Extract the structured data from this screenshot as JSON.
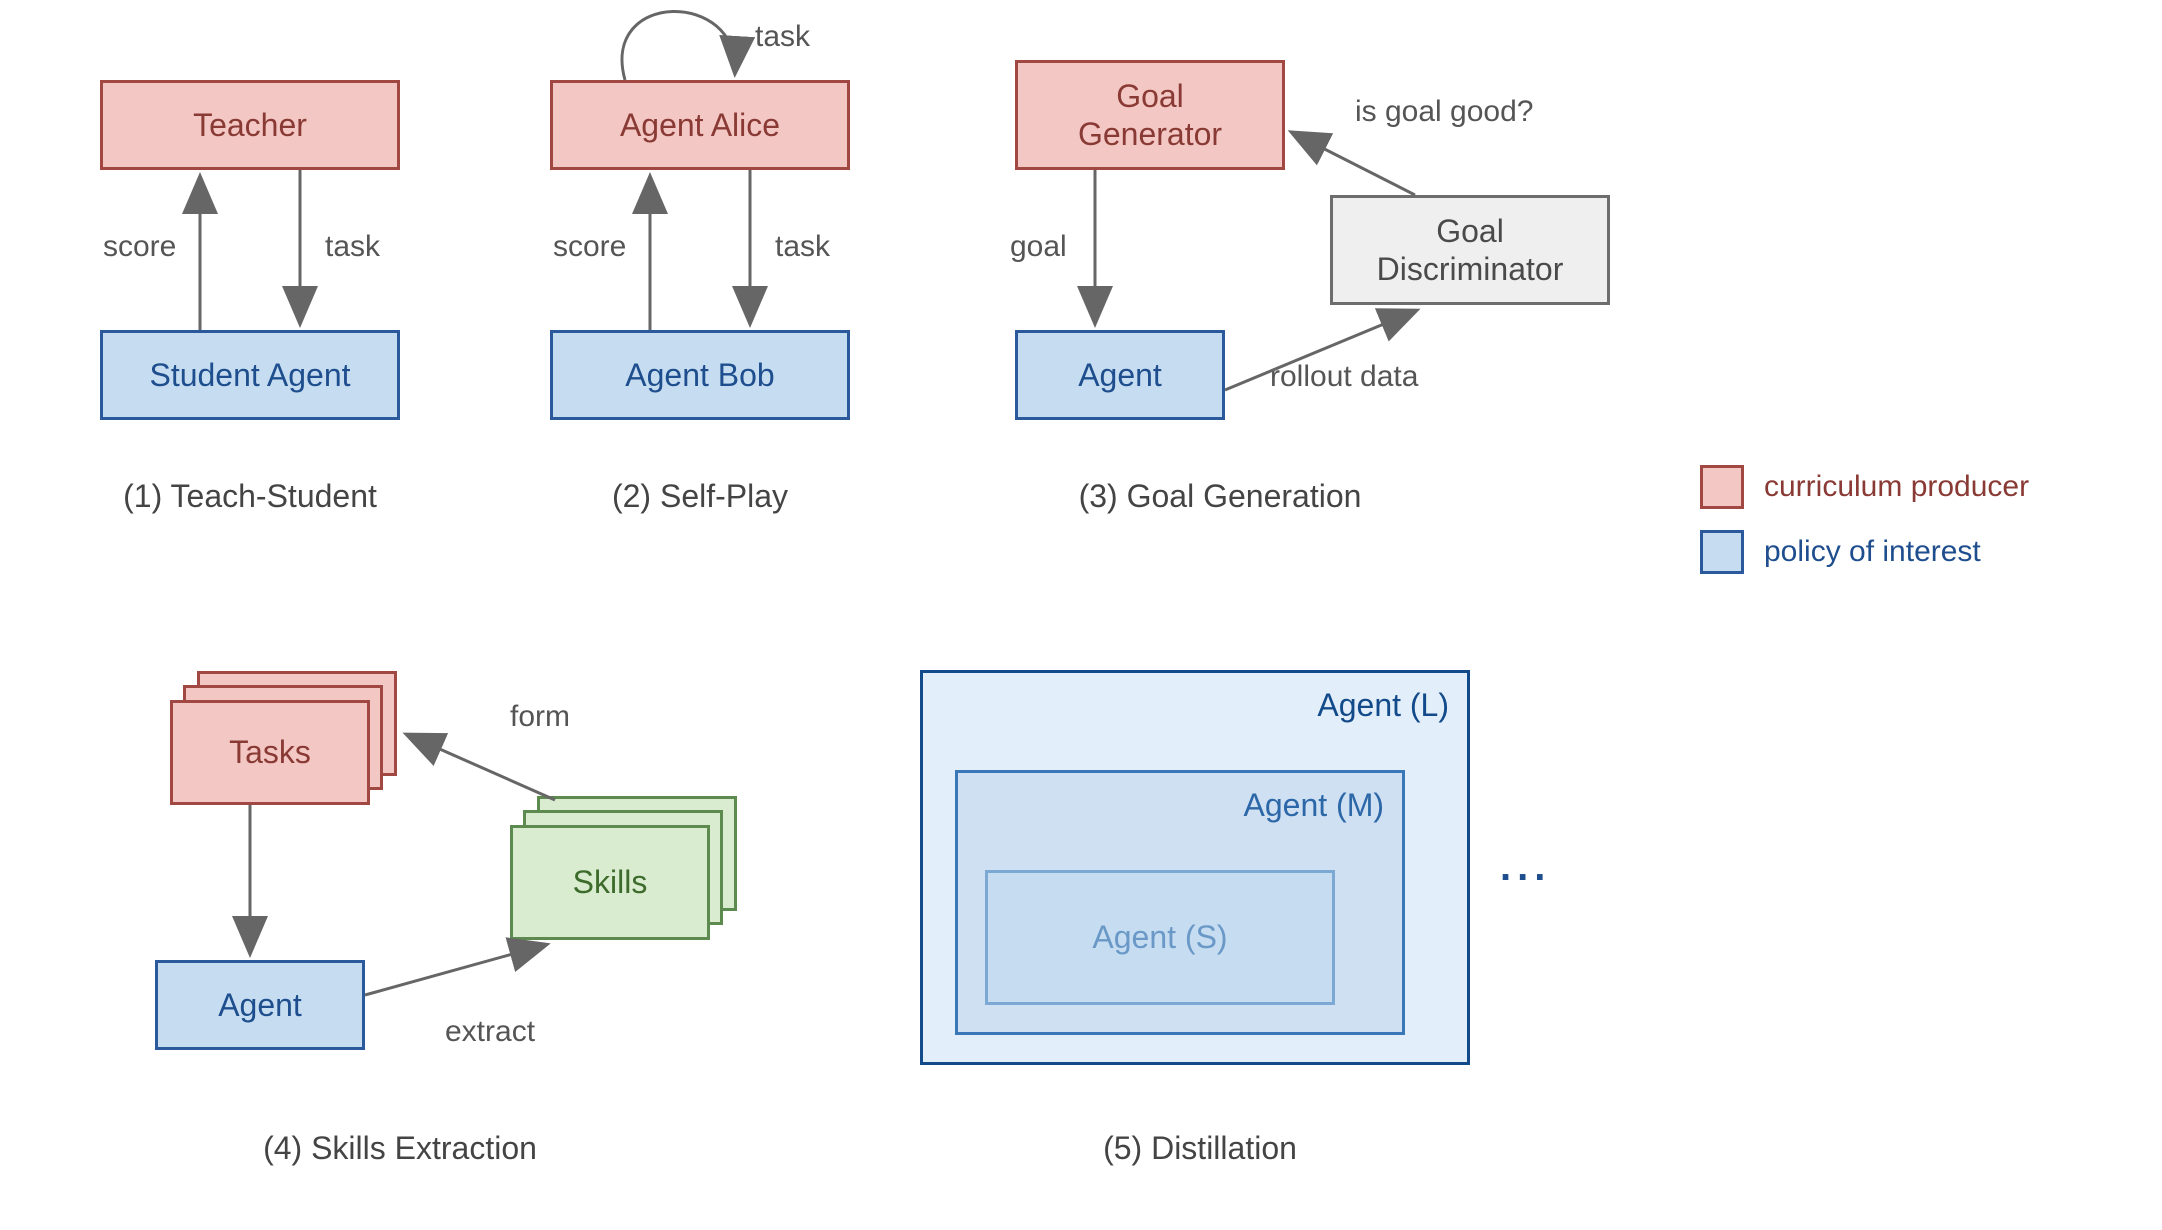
{
  "panels": {
    "p1": {
      "caption": "(1) Teach-Student",
      "teacher": "Teacher",
      "student": "Student Agent",
      "score": "score",
      "task": "task"
    },
    "p2": {
      "caption": "(2) Self-Play",
      "alice": "Agent Alice",
      "bob": "Agent Bob",
      "score": "score",
      "task": "task",
      "selfTask": "task"
    },
    "p3": {
      "caption": "(3) Goal Generation",
      "goalGen": "Goal\nGenerator",
      "agent": "Agent",
      "goalDisc": "Goal\nDiscriminator",
      "goal": "goal",
      "rollout": "rollout data",
      "isGood": "is goal good?"
    },
    "p4": {
      "caption": "(4) Skills Extraction",
      "tasks": "Tasks",
      "agent": "Agent",
      "skills": "Skills",
      "form": "form",
      "extract": "extract"
    },
    "p5": {
      "caption": "(5) Distillation",
      "agentL": "Agent (L)",
      "agentM": "Agent (M)",
      "agentS": "Agent (S)",
      "dots": "..."
    }
  },
  "legend": {
    "curriculum": "curriculum producer",
    "policy": "policy of interest"
  },
  "chart_data": {
    "type": "diagram",
    "title": "Curriculum learning approaches",
    "nodes": [
      {
        "id": "teacher",
        "panel": 1,
        "label": "Teacher",
        "role": "curriculum_producer"
      },
      {
        "id": "student",
        "panel": 1,
        "label": "Student Agent",
        "role": "policy_of_interest"
      },
      {
        "id": "alice",
        "panel": 2,
        "label": "Agent Alice",
        "role": "curriculum_producer"
      },
      {
        "id": "bob",
        "panel": 2,
        "label": "Agent Bob",
        "role": "policy_of_interest"
      },
      {
        "id": "goal_generator",
        "panel": 3,
        "label": "Goal Generator",
        "role": "curriculum_producer"
      },
      {
        "id": "agent3",
        "panel": 3,
        "label": "Agent",
        "role": "policy_of_interest"
      },
      {
        "id": "goal_discriminator",
        "panel": 3,
        "label": "Goal Discriminator",
        "role": "other"
      },
      {
        "id": "tasks",
        "panel": 4,
        "label": "Tasks",
        "role": "curriculum_producer"
      },
      {
        "id": "agent4",
        "panel": 4,
        "label": "Agent",
        "role": "policy_of_interest"
      },
      {
        "id": "skills",
        "panel": 4,
        "label": "Skills",
        "role": "other"
      },
      {
        "id": "agentL",
        "panel": 5,
        "label": "Agent (L)",
        "role": "policy_of_interest"
      },
      {
        "id": "agentM",
        "panel": 5,
        "label": "Agent (M)",
        "role": "policy_of_interest"
      },
      {
        "id": "agentS",
        "panel": 5,
        "label": "Agent (S)",
        "role": "policy_of_interest"
      }
    ],
    "edges": [
      {
        "from": "teacher",
        "to": "student",
        "label": "task"
      },
      {
        "from": "student",
        "to": "teacher",
        "label": "score"
      },
      {
        "from": "alice",
        "to": "bob",
        "label": "task"
      },
      {
        "from": "bob",
        "to": "alice",
        "label": "score"
      },
      {
        "from": "alice",
        "to": "alice",
        "label": "task"
      },
      {
        "from": "goal_generator",
        "to": "agent3",
        "label": "goal"
      },
      {
        "from": "agent3",
        "to": "goal_discriminator",
        "label": "rollout data"
      },
      {
        "from": "goal_discriminator",
        "to": "goal_generator",
        "label": "is goal good?"
      },
      {
        "from": "tasks",
        "to": "agent4",
        "label": ""
      },
      {
        "from": "agent4",
        "to": "skills",
        "label": "extract"
      },
      {
        "from": "skills",
        "to": "tasks",
        "label": "form"
      },
      {
        "from": "agentS",
        "to": "agentM",
        "label": "nested"
      },
      {
        "from": "agentM",
        "to": "agentL",
        "label": "nested"
      }
    ],
    "panels": [
      {
        "index": 1,
        "caption": "(1) Teach-Student"
      },
      {
        "index": 2,
        "caption": "(2) Self-Play"
      },
      {
        "index": 3,
        "caption": "(3) Goal Generation"
      },
      {
        "index": 4,
        "caption": "(4) Skills Extraction"
      },
      {
        "index": 5,
        "caption": "(5) Distillation"
      }
    ],
    "legend": [
      {
        "color": "red",
        "meaning": "curriculum producer"
      },
      {
        "color": "blue",
        "meaning": "policy of interest"
      }
    ]
  }
}
